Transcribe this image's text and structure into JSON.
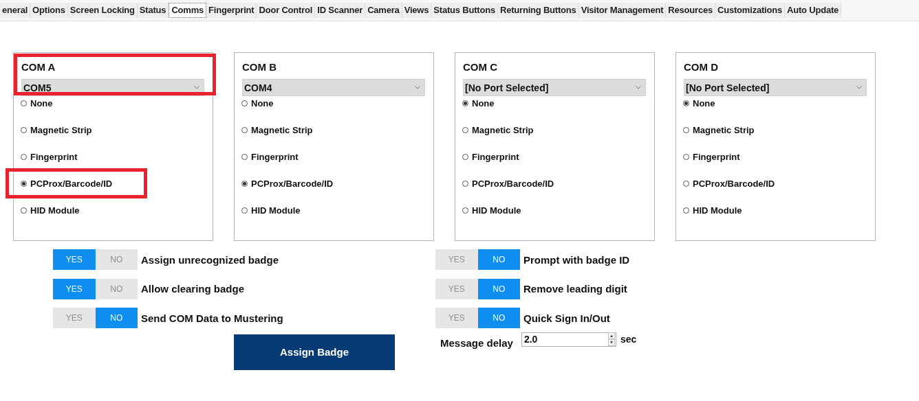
{
  "tabs": [
    {
      "label": "eneral",
      "selected": false
    },
    {
      "label": "Options",
      "selected": false
    },
    {
      "label": "Screen Locking",
      "selected": false
    },
    {
      "label": "Status",
      "selected": false
    },
    {
      "label": "Comms",
      "selected": true
    },
    {
      "label": "Fingerprint",
      "selected": false
    },
    {
      "label": "Door Control",
      "selected": false
    },
    {
      "label": "ID Scanner",
      "selected": false
    },
    {
      "label": "Camera",
      "selected": false
    },
    {
      "label": "Views",
      "selected": false
    },
    {
      "label": "Status Buttons",
      "selected": false
    },
    {
      "label": "Returning Buttons",
      "selected": false
    },
    {
      "label": "Visitor Management",
      "selected": false
    },
    {
      "label": "Resources",
      "selected": false
    },
    {
      "label": "Customizations",
      "selected": false
    },
    {
      "label": "Auto Update",
      "selected": false
    }
  ],
  "com_panels": [
    {
      "title": "COM A",
      "port": "COM5",
      "highlighted": true,
      "options": [
        {
          "label": "None",
          "selected": false,
          "highlighted": false
        },
        {
          "label": "Magnetic Strip",
          "selected": false,
          "highlighted": false
        },
        {
          "label": "Fingerprint",
          "selected": false,
          "highlighted": false
        },
        {
          "label": "PCProx/Barcode/ID",
          "selected": true,
          "highlighted": true
        },
        {
          "label": "HID Module",
          "selected": false,
          "highlighted": false
        }
      ]
    },
    {
      "title": "COM B",
      "port": "COM4",
      "highlighted": false,
      "options": [
        {
          "label": "None",
          "selected": false,
          "highlighted": false
        },
        {
          "label": "Magnetic Strip",
          "selected": false,
          "highlighted": false
        },
        {
          "label": "Fingerprint",
          "selected": false,
          "highlighted": false
        },
        {
          "label": "PCProx/Barcode/ID",
          "selected": true,
          "highlighted": false
        },
        {
          "label": "HID Module",
          "selected": false,
          "highlighted": false
        }
      ]
    },
    {
      "title": "COM C",
      "port": "[No Port Selected]",
      "highlighted": false,
      "options": [
        {
          "label": "None",
          "selected": true,
          "highlighted": false
        },
        {
          "label": "Magnetic Strip",
          "selected": false,
          "highlighted": false
        },
        {
          "label": "Fingerprint",
          "selected": false,
          "highlighted": false
        },
        {
          "label": "PCProx/Barcode/ID",
          "selected": false,
          "highlighted": false
        },
        {
          "label": "HID Module",
          "selected": false,
          "highlighted": false
        }
      ]
    },
    {
      "title": "COM D",
      "port": "[No Port Selected]",
      "highlighted": false,
      "options": [
        {
          "label": "None",
          "selected": true,
          "highlighted": false
        },
        {
          "label": "Magnetic Strip",
          "selected": false,
          "highlighted": false
        },
        {
          "label": "Fingerprint",
          "selected": false,
          "highlighted": false
        },
        {
          "label": "PCProx/Barcode/ID",
          "selected": false,
          "highlighted": false
        },
        {
          "label": "HID Module",
          "selected": false,
          "highlighted": false
        }
      ]
    }
  ],
  "left_toggles": [
    {
      "label": "Assign unrecognized badge",
      "yes": "YES",
      "no": "NO",
      "on": true
    },
    {
      "label": "Allow clearing badge",
      "yes": "YES",
      "no": "NO",
      "on": true
    },
    {
      "label": "Send COM Data to Mustering",
      "yes": "YES",
      "no": "NO",
      "on": false
    }
  ],
  "right_toggles": [
    {
      "label": "Prompt with badge ID",
      "yes": "YES",
      "no": "NO",
      "on": false
    },
    {
      "label": "Remove leading digit",
      "yes": "YES",
      "no": "NO",
      "on": false
    },
    {
      "label": "Quick Sign In/Out",
      "yes": "YES",
      "no": "NO",
      "on": false
    }
  ],
  "assign_button": "Assign Badge",
  "message_delay": {
    "label": "Message delay",
    "value": "2.0",
    "unit": "sec"
  }
}
